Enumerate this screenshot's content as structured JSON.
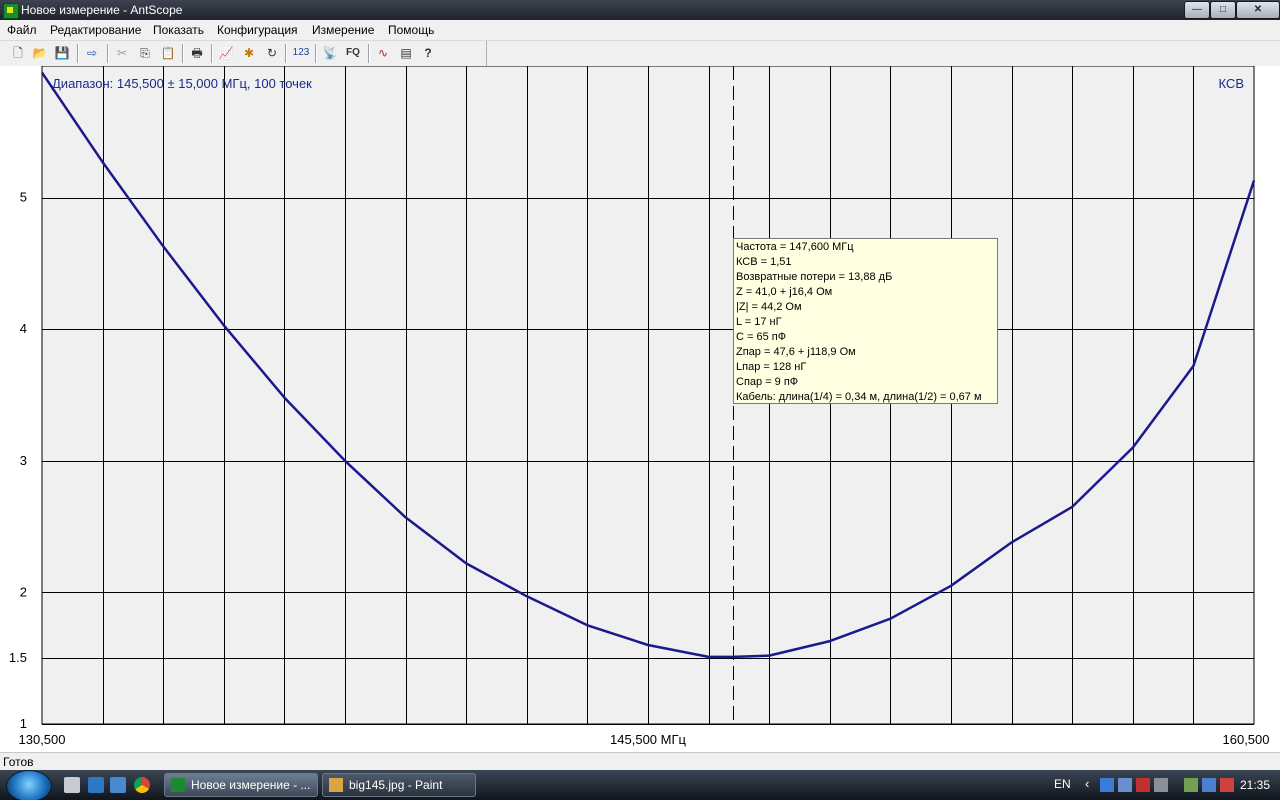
{
  "window": {
    "title": "Новое измерение - AntScope",
    "controls": {
      "minimize": "—",
      "maximize": "□",
      "close": "✕"
    }
  },
  "menu": [
    "Файл",
    "Редактирование",
    "Показать",
    "Конфигурация",
    "Измерение",
    "Помощь"
  ],
  "toolbar": {
    "buttons": [
      {
        "name": "new-icon",
        "glyph": "🗋"
      },
      {
        "name": "open-folder-icon",
        "glyph": "📂"
      },
      {
        "name": "save-icon",
        "glyph": "💾"
      },
      {
        "name": "export-icon",
        "glyph": "⇨"
      },
      {
        "name": "cut-icon",
        "glyph": "✂"
      },
      {
        "name": "copy-icon",
        "glyph": "⎘"
      },
      {
        "name": "paste-icon",
        "glyph": "📋"
      },
      {
        "name": "print-icon",
        "glyph": "🖶"
      },
      {
        "name": "chart-icon",
        "glyph": "📈"
      },
      {
        "name": "settings-star-icon",
        "glyph": "✱"
      },
      {
        "name": "refresh-icon",
        "glyph": "↻"
      },
      {
        "name": "numeric-icon",
        "glyph": "123"
      },
      {
        "name": "antenna-icon",
        "glyph": "📡"
      },
      {
        "name": "fq-icon",
        "glyph": "FQ"
      },
      {
        "name": "wave-icon",
        "glyph": "∿"
      },
      {
        "name": "list-icon",
        "glyph": "▤"
      },
      {
        "name": "help-icon",
        "glyph": "?"
      }
    ]
  },
  "chart": {
    "range_label": "Диапазон: 145,500 ± 15,000 МГц, 100 точек",
    "series_label": "КСВ",
    "x_tick_labels": [
      "130,500",
      "145,500 МГц",
      "160,500"
    ],
    "y_tick_labels": [
      "1",
      "1.5",
      "2",
      "3",
      "4",
      "5"
    ],
    "colors": {
      "plot_bg": "#f0f0f0",
      "grid": "#000000",
      "curve": "#1a1a8c",
      "label": "#1a2a8c"
    }
  },
  "chart_data": {
    "type": "line",
    "x_range": [
      130.5,
      160.5
    ],
    "y_range": [
      1,
      6.0
    ],
    "y_ticks": [
      1,
      1.5,
      2,
      3,
      4,
      5
    ],
    "grid": true,
    "cursor_x": 147.6,
    "series": [
      {
        "name": "КСВ",
        "x": [
          130.5,
          132.0,
          133.5,
          135.0,
          136.5,
          138.0,
          139.5,
          141.0,
          142.5,
          144.0,
          145.5,
          147.0,
          147.6,
          148.5,
          150.0,
          151.5,
          153.0,
          154.5,
          156.0,
          157.5,
          159.0,
          160.5
        ],
        "y": [
          5.95,
          5.27,
          4.63,
          4.03,
          3.48,
          3.0,
          2.57,
          2.22,
          1.97,
          1.75,
          1.6,
          1.51,
          1.51,
          1.52,
          1.63,
          1.8,
          2.05,
          2.38,
          2.65,
          3.1,
          3.72,
          5.13
        ]
      }
    ]
  },
  "info_box": {
    "lines": [
      "Частота = 147,600 МГц",
      "КСВ = 1,51",
      "Возвратные потери = 13,88 дБ",
      "Z = 41,0 + j16,4 Ом",
      "|Z| = 44,2 Ом",
      "L = 17 нГ",
      "C = 65 пФ",
      "Zпар = 47,6 + j118,9 Ом",
      "Lпар = 128 нГ",
      "Cпар = 9 пФ",
      "Кабель: длина(1/4) = 0,34 м, длина(1/2) = 0,67 м"
    ]
  },
  "status": {
    "text": "Готов"
  },
  "taskbar": {
    "tasks": [
      "Новое измерение - ...",
      "big145.jpg - Paint"
    ],
    "language": "EN",
    "clock": "21:35"
  }
}
